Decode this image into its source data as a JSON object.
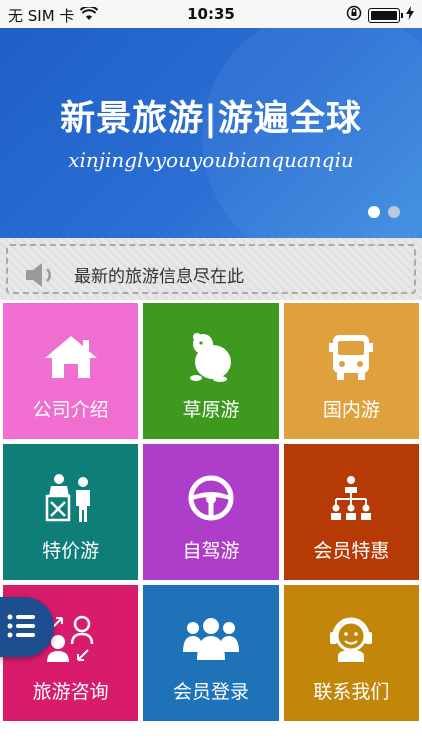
{
  "status_bar": {
    "carrier": "无 SIM 卡",
    "time": "10:35"
  },
  "banner": {
    "title": "新景旅游|游遍全球",
    "subtitle": "xinjinglvyouyoubianquanqiu",
    "page_count": 2,
    "active_page": 1
  },
  "notice": {
    "text": "最新的旅游信息尽在此"
  },
  "tiles": [
    {
      "label": "公司介绍",
      "color": "#f06ed0",
      "icon": "house-icon"
    },
    {
      "label": "草原游",
      "color": "#3d9a1f",
      "icon": "hamster-icon"
    },
    {
      "label": "国内游",
      "color": "#dfa13e",
      "icon": "bus-icon"
    },
    {
      "label": "特价游",
      "color": "#0f7d78",
      "icon": "checkpoint-icon"
    },
    {
      "label": "自驾游",
      "color": "#ae3ec9",
      "icon": "steering-wheel-icon"
    },
    {
      "label": "会员特惠",
      "color": "#b53a06",
      "icon": "org-chart-icon"
    },
    {
      "label": "旅游咨询",
      "color": "#d81b6b",
      "icon": "consult-icon"
    },
    {
      "label": "会员登录",
      "color": "#1d72b8",
      "icon": "members-icon"
    },
    {
      "label": "联系我们",
      "color": "#c2860b",
      "icon": "headset-icon"
    }
  ],
  "fab": {
    "icon": "list-menu-icon"
  }
}
